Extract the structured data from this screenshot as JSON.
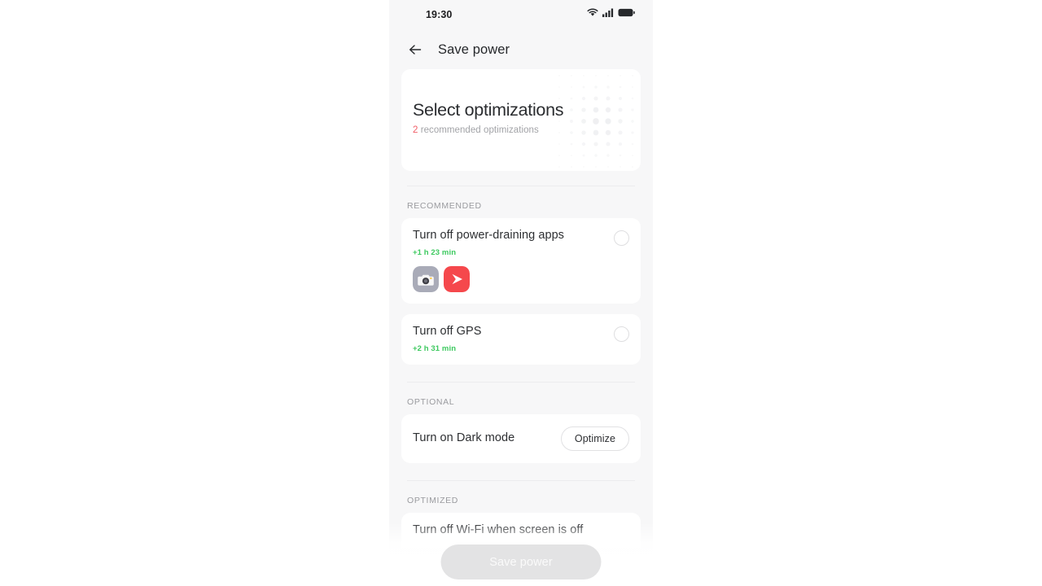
{
  "status_bar": {
    "time": "19:30",
    "icons": [
      "wifi-icon",
      "cellular-signal-icon",
      "battery-icon"
    ]
  },
  "header": {
    "back_icon": "back-arrow-icon",
    "title": "Save power"
  },
  "hero": {
    "title": "Select optimizations",
    "count": "2",
    "subtitle": " recommended optimizations",
    "accent_color": "#f05d67",
    "decoration": "dot-grid-pattern"
  },
  "sections": [
    {
      "label": "RECOMMENDED",
      "items": [
        {
          "title": "Turn off power-draining apps",
          "time_saved": "+1 h 23 min",
          "time_color": "#3dc95f",
          "control": "checkbox-circle",
          "checked": false,
          "apps": [
            {
              "name": "camera-app-icon",
              "bg": "#a9abb8"
            },
            {
              "name": "video-player-app-icon",
              "bg": "#f5484c"
            }
          ]
        },
        {
          "title": "Turn off GPS",
          "time_saved": "+2 h 31 min",
          "time_color": "#3dc95f",
          "control": "checkbox-circle",
          "checked": false,
          "apps": []
        }
      ]
    },
    {
      "label": "OPTIONAL",
      "items": [
        {
          "title": "Turn on Dark mode",
          "button_label": "Optimize",
          "control": "optimize-button"
        }
      ]
    },
    {
      "label": "OPTIMIZED",
      "items": [
        {
          "title": "Turn off Wi-Fi when screen is off",
          "control": "none"
        }
      ]
    }
  ],
  "bottom_bar": {
    "save_label": "Save power",
    "disabled": true
  }
}
